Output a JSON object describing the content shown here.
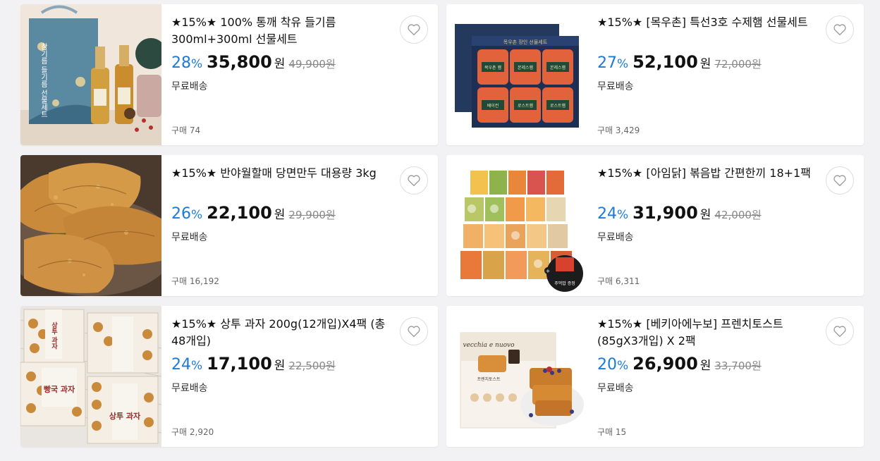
{
  "products": [
    {
      "title": "★15%★ 100% 통깨 착유 들기름 300ml+300ml 선물세트",
      "discount": "28",
      "price": "35,800",
      "original": "49,900원",
      "shipping": "무료배송",
      "purchases": "구매 74"
    },
    {
      "title": "★15%★ [목우촌] 특선3호 수제햄 선물세트",
      "discount": "27",
      "price": "52,100",
      "original": "72,000원",
      "shipping": "무료배송",
      "purchases": "구매 3,429"
    },
    {
      "title": "★15%★ 반야월할매 당면만두 대용량 3kg",
      "discount": "26",
      "price": "22,100",
      "original": "29,900원",
      "shipping": "무료배송",
      "purchases": "구매 16,192"
    },
    {
      "title": "★15%★ [아임닭] 볶음밥 간편한끼 18+1팩",
      "discount": "24",
      "price": "31,900",
      "original": "42,000원",
      "shipping": "무료배송",
      "purchases": "구매 6,311"
    },
    {
      "title": "★15%★ 상투 과자 200g(12개입)X4팩 (총 48개입)",
      "discount": "24",
      "price": "17,100",
      "original": "22,500원",
      "shipping": "무료배송",
      "purchases": "구매 2,920"
    },
    {
      "title": "★15%★ [베키아에누보] 프렌치토스트 (85gX3개입) X 2팩",
      "discount": "20",
      "price": "26,900",
      "original": "33,700원",
      "shipping": "무료배송",
      "purchases": "구매 15"
    }
  ],
  "labels": {
    "percent": "%",
    "won": "원"
  },
  "thumb_text": {
    "p1_box": "참기름 들기름 선물세트",
    "p1_bottle": "통참기름",
    "p2_header": "목우촌 장인 선물세트",
    "p2_tiles": [
      "목우촌 햄",
      "본레스햄",
      "본레스햄",
      "베이컨",
      "로스트햄",
      "로스트햄"
    ],
    "p4_badge": "주먹밥 증정",
    "p5_box": "상투 과자",
    "p5_box2": "빵국 과자",
    "p6_brand": "vecchia e nuovo",
    "p6_sub": "프렌치토스트"
  },
  "colors": {
    "accent": "#1c7ad8",
    "text": "#111111",
    "muted": "#666666",
    "strike": "#888888",
    "background": "#f2f2f4"
  }
}
